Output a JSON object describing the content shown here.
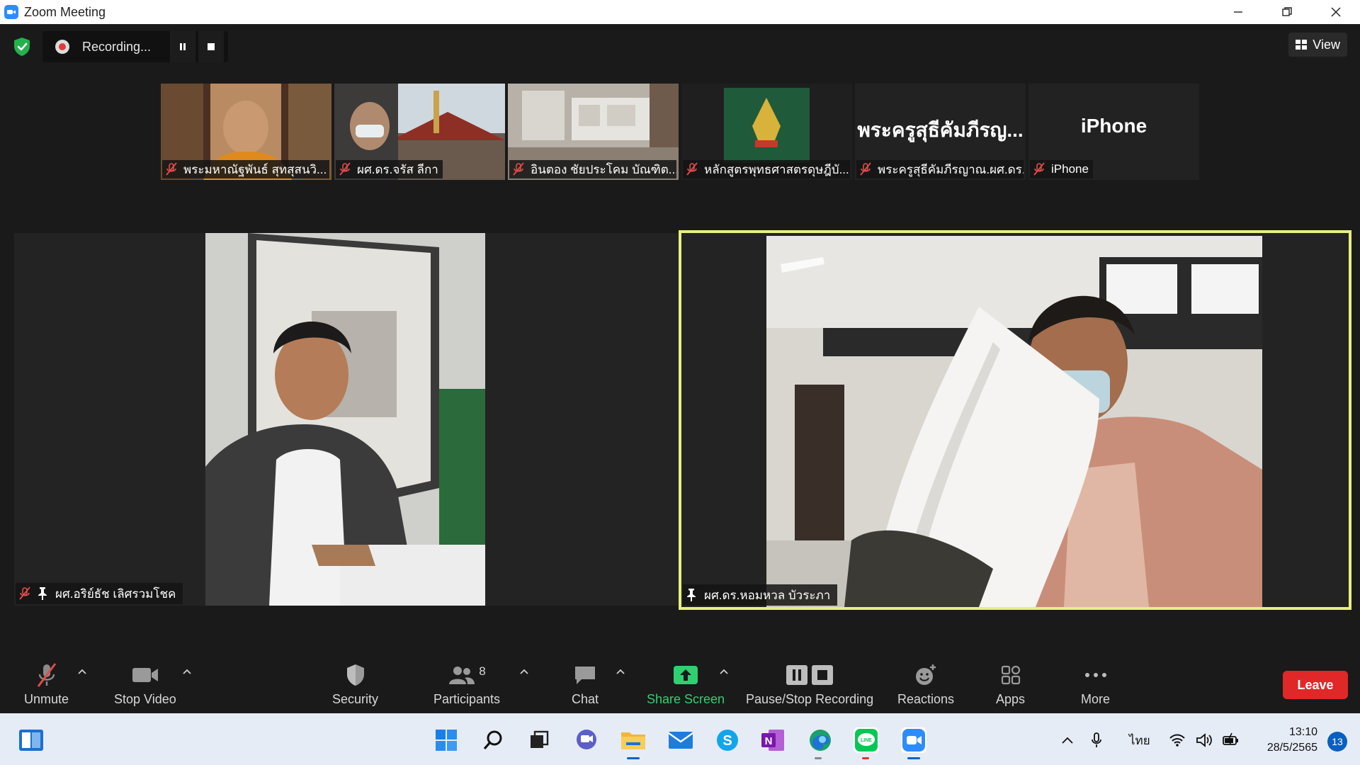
{
  "window": {
    "title": "Zoom Meeting"
  },
  "topbar": {
    "recording_label": "Recording...",
    "view_label": "View"
  },
  "thumbnails": [
    {
      "name": "พระมหาณัฐพันธ์ สุทสุสนวิ...",
      "muted": true
    },
    {
      "name": "ผศ.ดร.จรัส ลีกา",
      "muted": true
    },
    {
      "name": "อินตอง ชัยประโคม บัณฑิต...",
      "muted": true
    },
    {
      "name": "หลักสูตรพุทธศาสตรดุษฎีบั...",
      "muted": true
    },
    {
      "name": "พระครูสุธีคัมภีรญาณ.ผศ.ดร.",
      "display": "พระครูสุธีคัมภีรญ...",
      "muted": true
    },
    {
      "name": "iPhone",
      "display": "iPhone",
      "muted": true
    }
  ],
  "main_tiles": [
    {
      "name": "ผศ.อริย์ธัช เลิศรวมโชค",
      "muted": true,
      "pinned": true
    },
    {
      "name": "ผศ.ดร.หอมหวล บัวระภา",
      "muted": false,
      "pinned": true,
      "active_speaker": true
    }
  ],
  "toolbar": {
    "unmute": "Unmute",
    "stop_video": "Stop Video",
    "security": "Security",
    "participants": "Participants",
    "participants_count": "8",
    "chat": "Chat",
    "share_screen": "Share Screen",
    "pause_stop_recording": "Pause/Stop Recording",
    "reactions": "Reactions",
    "apps": "Apps",
    "more": "More",
    "leave": "Leave"
  },
  "taskbar": {
    "language": "ไทย",
    "time": "13:10",
    "date": "28/5/2565",
    "notifications": "13"
  },
  "colors": {
    "active_speaker_border": "#e6ef7e",
    "leave": "#e02828",
    "share": "#2fd06f",
    "zoom_blue": "#2d8cff"
  }
}
